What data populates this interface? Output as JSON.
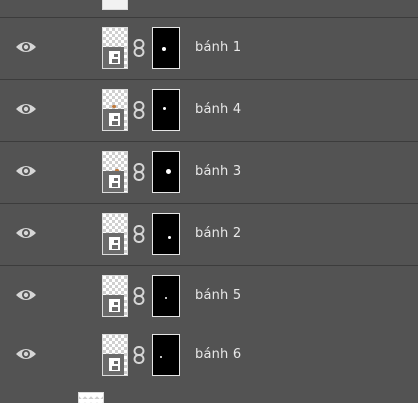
{
  "layers_panel": {
    "layers": [
      {
        "name": "bánh 1",
        "visible": true,
        "content_mark": false,
        "icon": "smart-object-icon",
        "mask_icon": "layer-mask-icon"
      },
      {
        "name": "bánh 4",
        "visible": true,
        "content_mark": true,
        "icon": "smart-object-icon",
        "mask_icon": "layer-mask-icon"
      },
      {
        "name": "bánh 3",
        "visible": true,
        "content_mark": true,
        "icon": "smart-object-icon",
        "mask_icon": "layer-mask-icon"
      },
      {
        "name": "bánh 2",
        "visible": true,
        "content_mark": false,
        "icon": "smart-object-icon",
        "mask_icon": "layer-mask-icon"
      },
      {
        "name": "bánh 5",
        "visible": true,
        "content_mark": false,
        "icon": "smart-object-icon",
        "mask_icon": "layer-mask-icon"
      },
      {
        "name": "bánh 6",
        "visible": true,
        "content_mark": false,
        "icon": "smart-object-icon",
        "mask_icon": "layer-mask-icon"
      }
    ]
  },
  "colors": {
    "panel_bg": "#535353",
    "row_divider": "#3c3c3c",
    "text": "#e8e8e8",
    "icon": "#d6d6d6",
    "mask_bg": "#000000",
    "mask_content": "#ffffff"
  }
}
